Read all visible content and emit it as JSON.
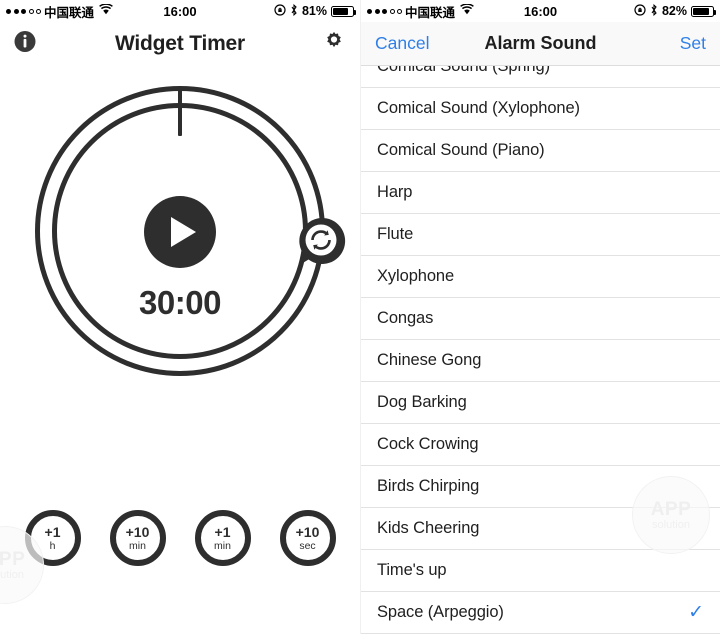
{
  "left_screen": {
    "status_bar": {
      "carrier": "中国联通",
      "signal_filled_dots": 3,
      "signal_empty_dots": 2,
      "wifi_icon": "wifi-icon",
      "time": "16:00",
      "rotation_lock_icon": "rotation-lock-icon",
      "bluetooth_icon": "bluetooth-icon",
      "battery_percent": "81%",
      "battery_level": 81
    },
    "nav": {
      "info_icon": "info-icon",
      "title": "Widget Timer",
      "settings_icon": "gear-icon"
    },
    "timer": {
      "display_time": "30:00",
      "play_icon": "play-icon",
      "repeat_icon": "repeat-icon",
      "ring_color": "#2e2e2e"
    },
    "add_buttons": [
      {
        "amount": "+1",
        "unit": "h"
      },
      {
        "amount": "+10",
        "unit": "min"
      },
      {
        "amount": "+1",
        "unit": "min"
      },
      {
        "amount": "+10",
        "unit": "sec"
      }
    ],
    "watermark": {
      "line1": "APP",
      "line2": "solution"
    }
  },
  "right_screen": {
    "status_bar": {
      "carrier": "中国联通",
      "signal_filled_dots": 3,
      "signal_empty_dots": 2,
      "wifi_icon": "wifi-icon",
      "time": "16:00",
      "rotation_lock_icon": "rotation-lock-icon",
      "bluetooth_icon": "bluetooth-icon",
      "battery_percent": "82%",
      "battery_level": 82
    },
    "nav": {
      "cancel_label": "Cancel",
      "title": "Alarm Sound",
      "set_label": "Set",
      "accent_color": "#2f7fe8"
    },
    "sounds": [
      {
        "label": "Comical Sound (Spring)",
        "selected": false
      },
      {
        "label": "Comical Sound (Xylophone)",
        "selected": false
      },
      {
        "label": "Comical Sound (Piano)",
        "selected": false
      },
      {
        "label": "Harp",
        "selected": false
      },
      {
        "label": "Flute",
        "selected": false
      },
      {
        "label": "Xylophone",
        "selected": false
      },
      {
        "label": "Congas",
        "selected": false
      },
      {
        "label": "Chinese Gong",
        "selected": false
      },
      {
        "label": "Dog Barking",
        "selected": false
      },
      {
        "label": "Cock Crowing",
        "selected": false
      },
      {
        "label": "Birds Chirping",
        "selected": false
      },
      {
        "label": "Kids Cheering",
        "selected": false
      },
      {
        "label": "Time's up",
        "selected": false
      },
      {
        "label": "Space (Arpeggio)",
        "selected": true
      }
    ],
    "checkmark_glyph": "✓",
    "watermark": {
      "line1": "APP",
      "line2": "solution"
    }
  }
}
